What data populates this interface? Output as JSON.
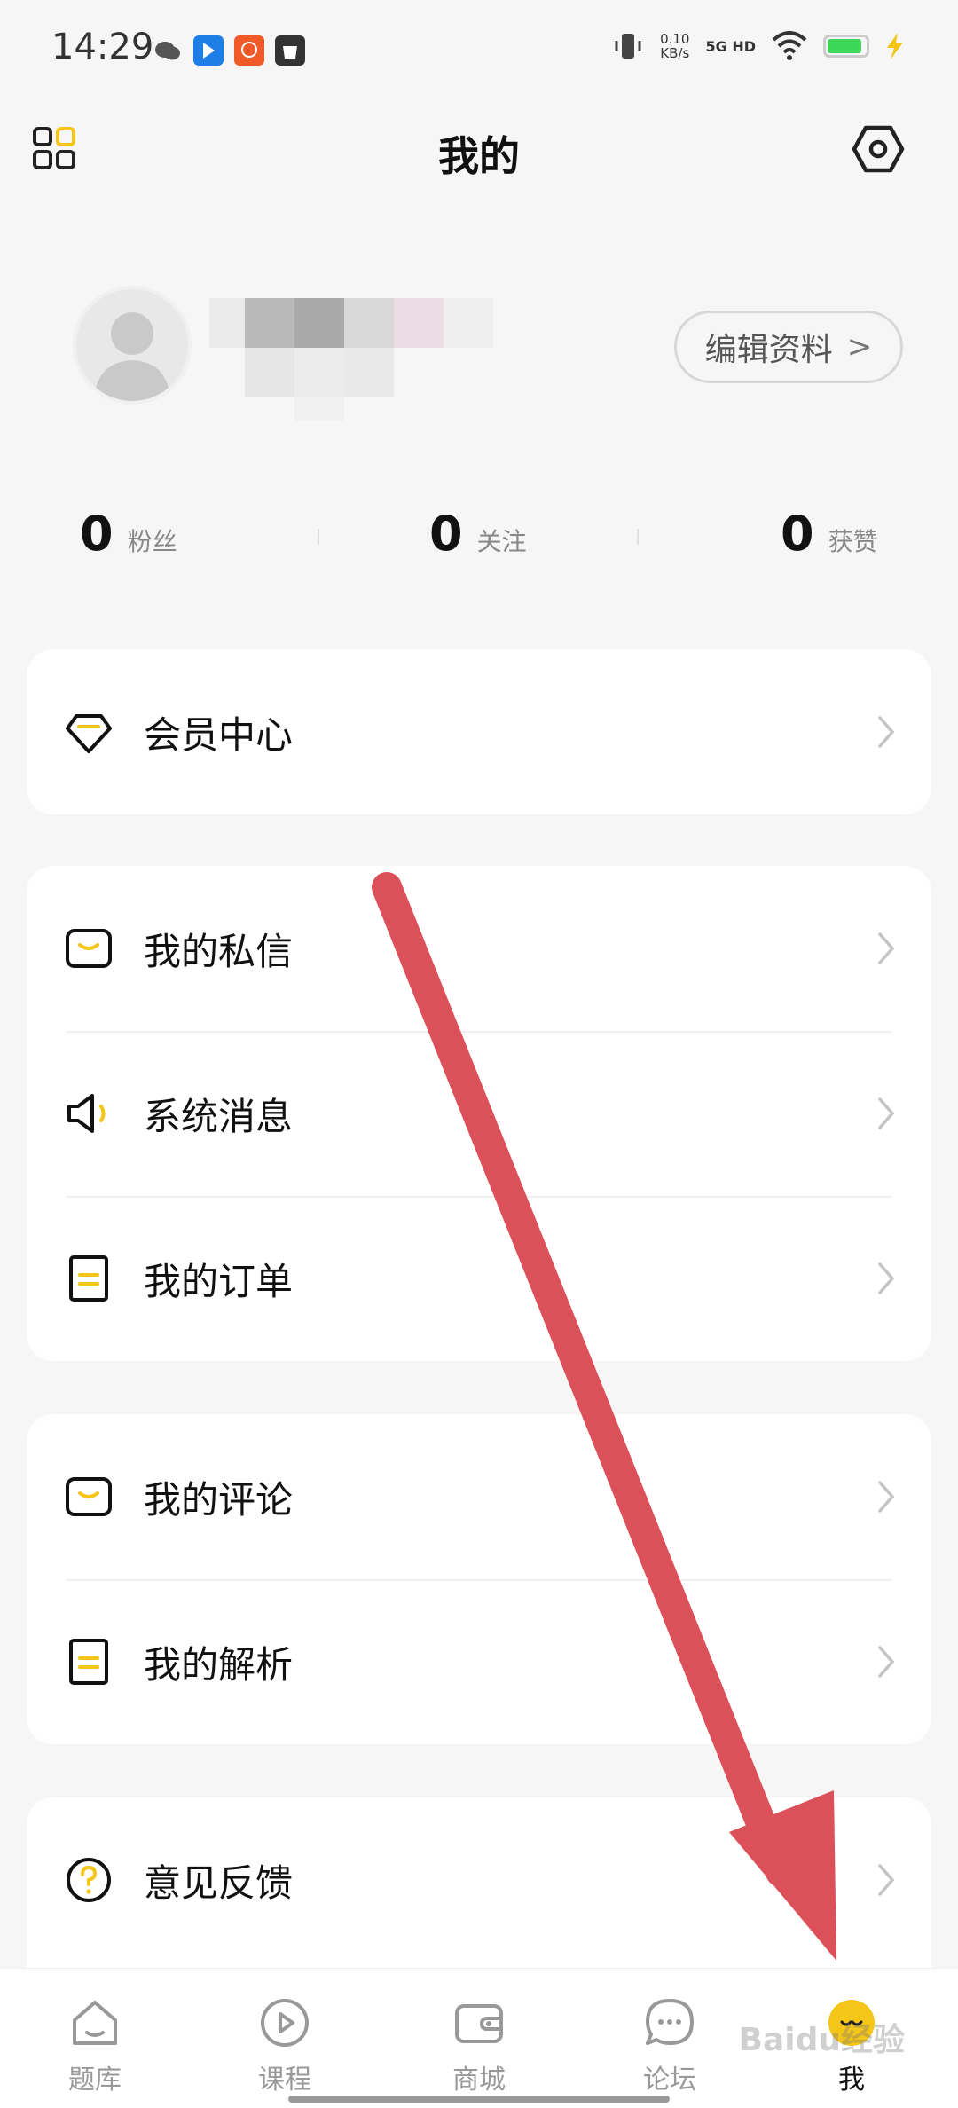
{
  "status_bar": {
    "time": "14:29",
    "net_speed_value": "0.10",
    "net_speed_unit": "KB/s",
    "network": "5G HD",
    "battery_color": "#3ed659",
    "charging_color": "#f5c518"
  },
  "header": {
    "title": "我的",
    "left_icon": "grid-icon",
    "right_icon": "settings-icon"
  },
  "profile": {
    "edit_label": "编辑资料",
    "edit_chevron": ">"
  },
  "stats": [
    {
      "value": "0",
      "label": "粉丝"
    },
    {
      "value": "0",
      "label": "关注"
    },
    {
      "value": "0",
      "label": "获赞"
    }
  ],
  "menu": {
    "vip": {
      "label": "会员中心",
      "icon": "diamond-icon"
    },
    "messages": {
      "label": "我的私信",
      "icon": "message-icon"
    },
    "system": {
      "label": "系统消息",
      "icon": "speaker-icon"
    },
    "orders": {
      "label": "我的订单",
      "icon": "order-icon"
    },
    "comments": {
      "label": "我的评论",
      "icon": "comment-icon"
    },
    "analysis": {
      "label": "我的解析",
      "icon": "analysis-icon"
    },
    "feedback": {
      "label": "意见反馈",
      "icon": "question-icon"
    }
  },
  "bottom_nav": [
    {
      "label": "题库",
      "icon": "home-icon"
    },
    {
      "label": "课程",
      "icon": "play-icon"
    },
    {
      "label": "商城",
      "icon": "wallet-icon"
    },
    {
      "label": "论坛",
      "icon": "chat-icon"
    },
    {
      "label": "我",
      "icon": "face-icon",
      "active": true
    }
  ],
  "colors": {
    "accent_yellow": "#f5c518",
    "arrow_red": "#dc505a",
    "background": "#f6f6f6"
  },
  "watermark": "Baidu经验"
}
